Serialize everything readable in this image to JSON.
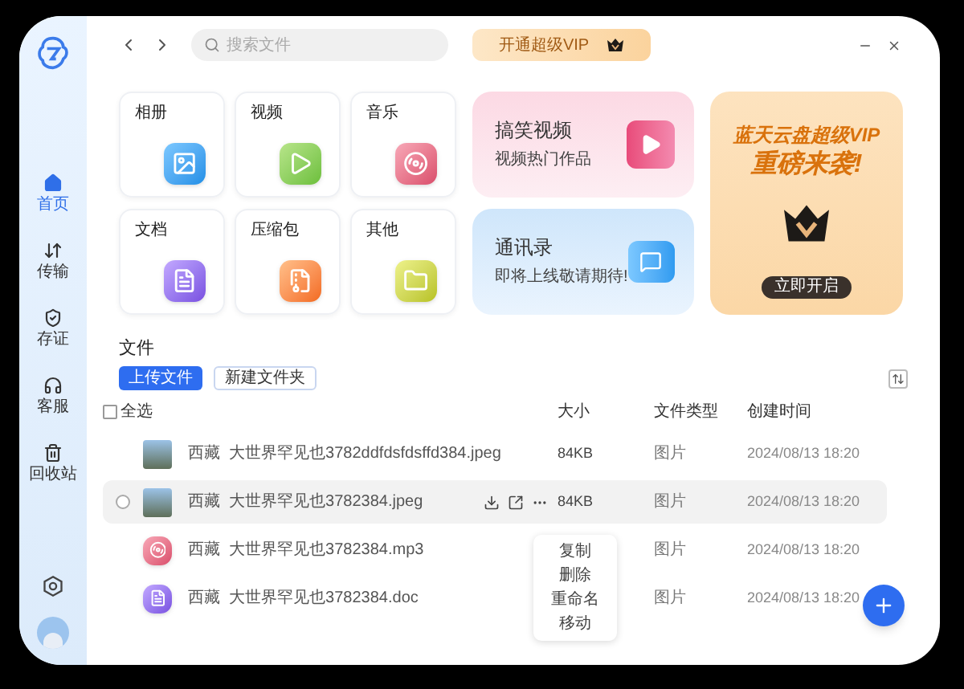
{
  "search": {
    "placeholder": "搜索文件"
  },
  "vip_button": {
    "label": "开通超级VIP"
  },
  "sidebar": {
    "items": [
      {
        "label": "首页",
        "kind": "home",
        "selected": true
      },
      {
        "label": "传输",
        "kind": "transfer",
        "selected": false
      },
      {
        "label": "存证",
        "kind": "certificate",
        "selected": false
      },
      {
        "label": "客服",
        "kind": "service",
        "selected": false
      },
      {
        "label": "回收站",
        "kind": "trash",
        "selected": false
      }
    ]
  },
  "categories": [
    {
      "label": "相册",
      "kind": "image"
    },
    {
      "label": "视频",
      "kind": "video"
    },
    {
      "label": "音乐",
      "kind": "music"
    },
    {
      "label": "文档",
      "kind": "document"
    },
    {
      "label": "压缩包",
      "kind": "archive"
    },
    {
      "label": "其他",
      "kind": "folder"
    }
  ],
  "promos": [
    {
      "title": "搞笑视频",
      "subtitle": "视频热门作品",
      "kind": "video"
    },
    {
      "title": "通讯录",
      "subtitle": "即将上线敬请期待!",
      "kind": "chat"
    }
  ],
  "vip_banner": {
    "headline": "蓝天云盘超级VIP",
    "subheadline": "重磅来袭!",
    "button": "立即开启"
  },
  "files": {
    "title": "文件",
    "buttons": [
      {
        "label": "上传文件",
        "kind": "primary"
      },
      {
        "label": "新建文件夹",
        "kind": "secondary"
      }
    ],
    "select_all": {
      "label": "全选",
      "checked": false
    },
    "columns": [
      "大小",
      "文件类型",
      "创建时间"
    ],
    "rows": [
      {
        "name": "西藏  大世界罕见也3782ddfdsfdsffd384.jpeg",
        "kind": "image",
        "size": "84KB",
        "type": "图片",
        "created": "2024/08/13 18:20",
        "highlighted": false
      },
      {
        "name": "西藏  大世界罕见也3782384.jpeg",
        "kind": "image",
        "size": "84KB",
        "type": "图片",
        "created": "2024/08/13 18:20",
        "highlighted": true
      },
      {
        "name": "西藏  大世界罕见也3782384.mp3",
        "kind": "music",
        "type": "图片",
        "created": "2024/08/13 18:20",
        "highlighted": false
      },
      {
        "name": "西藏  大世界罕见也3782384.doc",
        "kind": "document",
        "type": "图片",
        "created": "2024/08/13 18:20",
        "highlighted": false
      }
    ]
  },
  "context_menu": {
    "items": [
      "复制",
      "删除",
      "重命名",
      "移动"
    ]
  }
}
